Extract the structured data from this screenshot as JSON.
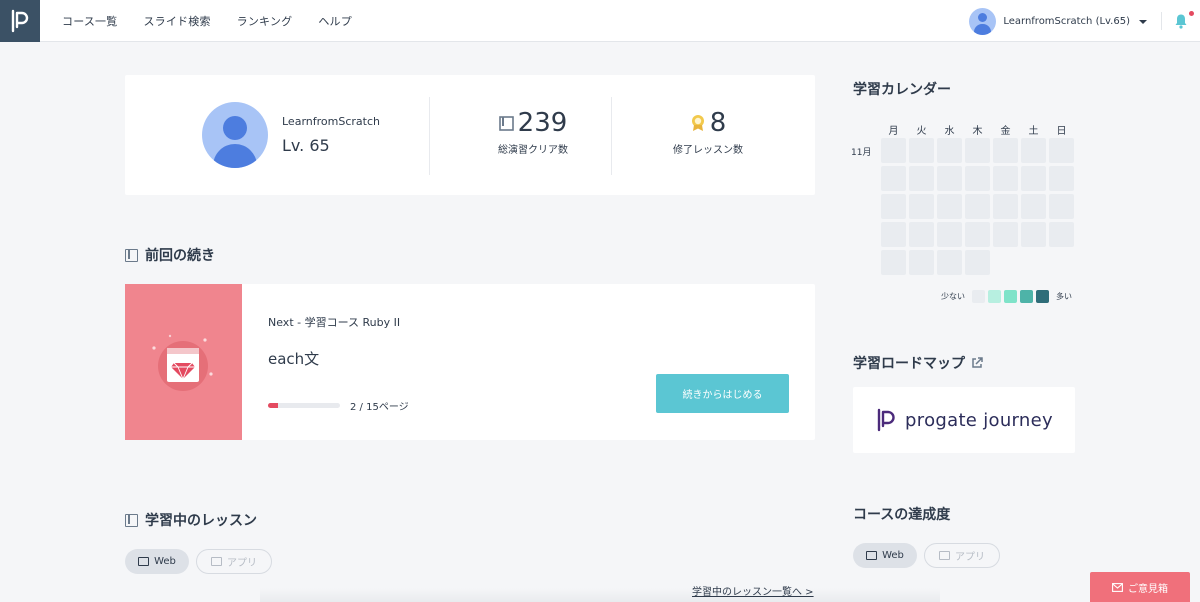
{
  "header": {
    "nav": [
      "コース一覧",
      "スライド検索",
      "ランキング",
      "ヘルプ"
    ],
    "user_name": "LearnfromScratch (Lv.65)"
  },
  "profile": {
    "name": "LearnfromScratch",
    "level": "Lv. 65",
    "stats": [
      {
        "value": "239",
        "label": "総演習クリア数",
        "icon": "book-icon"
      },
      {
        "value": "8",
        "label": "修了レッスン数",
        "icon": "medal-icon"
      }
    ]
  },
  "continue": {
    "section_title": "前回の続き",
    "next": "Next - 学習コース Ruby II",
    "lesson_title": "each文",
    "progress_fraction": 0.133,
    "pages": "2 / 15ページ",
    "button": "続きからはじめる",
    "colors": {
      "image_bg": "#f0858e",
      "button": "#5bc6d3",
      "progress": "#e44a60"
    }
  },
  "lessons": {
    "section_title": "学習中のレッスン",
    "tabs": [
      "Web",
      "アプリ"
    ],
    "more_link": "学習中のレッスン一覧へ >"
  },
  "calendar": {
    "title": "学習カレンダー",
    "days": [
      "月",
      "火",
      "水",
      "木",
      "金",
      "土",
      "日"
    ],
    "month": "11月",
    "legend_less": "少ない",
    "legend_more": "多い",
    "legend_colors": [
      "#e9ecf0",
      "#b7efe0",
      "#7fe3c9",
      "#4eb3a8",
      "#2f6d79"
    ]
  },
  "roadmap": {
    "title": "学習ロードマップ",
    "journey_text": "progate journey"
  },
  "achievement": {
    "title": "コースの達成度",
    "tabs": [
      "Web",
      "アプリ"
    ]
  },
  "opinion_button": "ご意見箱"
}
